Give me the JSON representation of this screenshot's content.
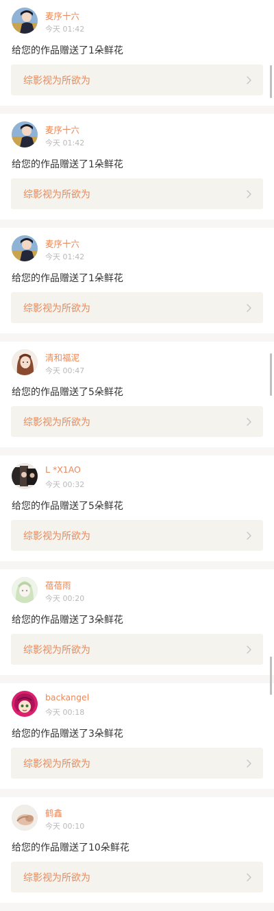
{
  "notifications": [
    {
      "username": "麦序十六",
      "time": "今天 01:42",
      "message": "给您的作品赠送了1朵鲜花",
      "work_title": "综影视为所欲为",
      "avatar_icon": "avatar-boy-icon"
    },
    {
      "username": "麦序十六",
      "time": "今天 01:42",
      "message": "给您的作品赠送了1朵鲜花",
      "work_title": "综影视为所欲为",
      "avatar_icon": "avatar-boy-icon"
    },
    {
      "username": "麦序十六",
      "time": "今天 01:42",
      "message": "给您的作品赠送了1朵鲜花",
      "work_title": "综影视为所欲为",
      "avatar_icon": "avatar-boy-icon"
    },
    {
      "username": "清和福泥",
      "time": "今天 00:47",
      "message": "给您的作品赠送了5朵鲜花",
      "work_title": "综影视为所欲为",
      "avatar_icon": "avatar-girl-icon"
    },
    {
      "username": "L *X1AO",
      "time": "今天 00:32",
      "message": "给您的作品赠送了5朵鲜花",
      "work_title": "综影视为所欲为",
      "avatar_icon": "avatar-photo-icon"
    },
    {
      "username": "蓓蓓雨",
      "time": "今天 00:20",
      "message": "给您的作品赠送了3朵鲜花",
      "work_title": "综影视为所欲为",
      "avatar_icon": "avatar-anime-icon"
    },
    {
      "username": "backangel",
      "time": "今天 00:18",
      "message": "给您的作品赠送了3朵鲜花",
      "work_title": "综影视为所欲为",
      "avatar_icon": "avatar-cartoon-icon"
    },
    {
      "username": "鹤鑫",
      "time": "今天 00:10",
      "message": "给您的作品赠送了10朵鲜花",
      "work_title": "综影视为所欲为",
      "avatar_icon": "avatar-hand-icon"
    }
  ],
  "colors": {
    "accent": "#e9895a",
    "text": "#333333",
    "muted": "#b9b9b9",
    "link_bg": "#f4f3ee",
    "page_bg": "#f7f6f4"
  }
}
